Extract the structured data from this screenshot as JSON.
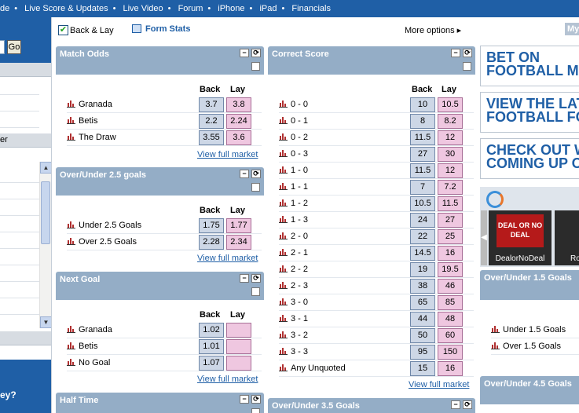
{
  "topnav": [
    "de",
    "Live Score & Updates",
    "Live Video",
    "Forum",
    "iPhone",
    "iPad",
    "Financials"
  ],
  "left": {
    "go_label": "Go",
    "row_text": "er",
    "bottom_text": "ey?"
  },
  "toolbar": {
    "back_lay": "Back & Lay",
    "back_lay_checked": true,
    "form_stats": "Form Stats",
    "more_options": "More options",
    "my": "My"
  },
  "markets": {
    "match_odds": {
      "title": "Match Odds",
      "back": "Back",
      "lay": "Lay",
      "view": "View full market",
      "rows": [
        {
          "name": "Granada",
          "back": "3.7",
          "lay": "3.8"
        },
        {
          "name": "Betis",
          "back": "2.2",
          "lay": "2.24"
        },
        {
          "name": "The Draw",
          "back": "3.55",
          "lay": "3.6"
        }
      ]
    },
    "over_under_25": {
      "title": "Over/Under 2.5 goals",
      "back": "Back",
      "lay": "Lay",
      "view": "View full market",
      "rows": [
        {
          "name": "Under 2.5 Goals",
          "back": "1.75",
          "lay": "1.77"
        },
        {
          "name": "Over 2.5 Goals",
          "back": "2.28",
          "lay": "2.34"
        }
      ]
    },
    "next_goal": {
      "title": "Next Goal",
      "back": "Back",
      "lay": "Lay",
      "view": "View full market",
      "rows": [
        {
          "name": "Granada",
          "back": "1.02",
          "lay": ""
        },
        {
          "name": "Betis",
          "back": "1.01",
          "lay": ""
        },
        {
          "name": "No Goal",
          "back": "1.07",
          "lay": ""
        }
      ]
    },
    "half_time": {
      "title": "Half Time"
    },
    "correct_score": {
      "title": "Correct Score",
      "back": "Back",
      "lay": "Lay",
      "view": "View full market",
      "rows": [
        {
          "name": "0 - 0",
          "back": "10",
          "lay": "10.5"
        },
        {
          "name": "0 - 1",
          "back": "8",
          "lay": "8.2"
        },
        {
          "name": "0 - 2",
          "back": "11.5",
          "lay": "12"
        },
        {
          "name": "0 - 3",
          "back": "27",
          "lay": "30"
        },
        {
          "name": "1 - 0",
          "back": "11.5",
          "lay": "12"
        },
        {
          "name": "1 - 1",
          "back": "7",
          "lay": "7.2"
        },
        {
          "name": "1 - 2",
          "back": "10.5",
          "lay": "11.5"
        },
        {
          "name": "1 - 3",
          "back": "24",
          "lay": "27"
        },
        {
          "name": "2 - 0",
          "back": "22",
          "lay": "25"
        },
        {
          "name": "2 - 1",
          "back": "14.5",
          "lay": "16"
        },
        {
          "name": "2 - 2",
          "back": "19",
          "lay": "19.5"
        },
        {
          "name": "2 - 3",
          "back": "38",
          "lay": "46"
        },
        {
          "name": "3 - 0",
          "back": "65",
          "lay": "85"
        },
        {
          "name": "3 - 1",
          "back": "44",
          "lay": "48"
        },
        {
          "name": "3 - 2",
          "back": "50",
          "lay": "60"
        },
        {
          "name": "3 - 3",
          "back": "95",
          "lay": "150"
        },
        {
          "name": "Any Unquoted",
          "back": "15",
          "lay": "16"
        }
      ]
    },
    "over_under_35": {
      "title": "Over/Under 3.5 Goals"
    },
    "over_under_15": {
      "title": "Over/Under 1.5 Goals",
      "rows": [
        {
          "name": "Under 1.5 Goals"
        },
        {
          "name": "Over 1.5 Goals"
        }
      ]
    },
    "over_under_45": {
      "title": "Over/Under 4.5 Goals"
    }
  },
  "ads": {
    "ad1": "BET ON FOOTBALL MU",
    "ad2": "VIEW THE LAT FOOTBALL FO",
    "ad3": "CHECK OUT W COMING UP O",
    "tv1": "DealorNoDeal",
    "tv1_art": "DEAL OR NO DEAL",
    "tv2": "Ro"
  },
  "colors": {
    "nav": "#1f5fa6",
    "panel_header": "#94adc6",
    "back": "#cdd7e6",
    "lay": "#efc7e0"
  }
}
